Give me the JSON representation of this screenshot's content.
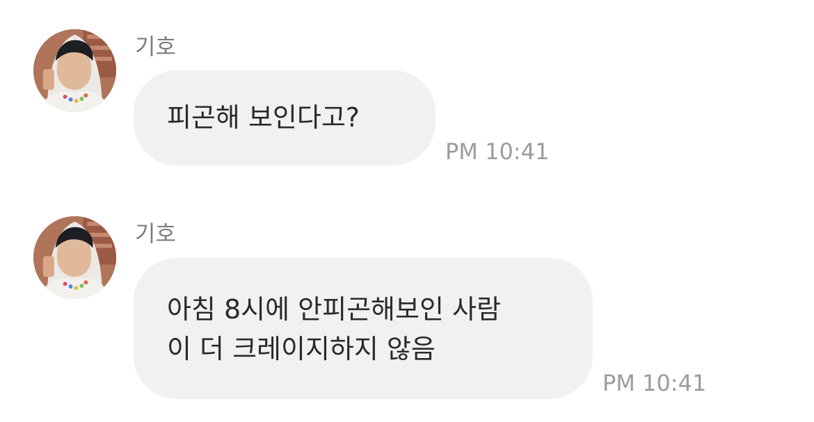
{
  "conversation": {
    "messages": [
      {
        "sender": "기호",
        "text": "피곤해 보인다고?",
        "time": "PM 10:41",
        "avatar": "profile-photo"
      },
      {
        "sender": "기호",
        "text": "아침 8시에 안피곤해보인 사람\n이 더 크레이지하지 않음",
        "time": "PM 10:41",
        "avatar": "profile-photo"
      }
    ]
  },
  "colors": {
    "bubble": "#f1f1f3",
    "message_text": "#2a2a2c",
    "sender_name": "#7d7d7d",
    "timestamp": "#9b9ba0",
    "background": "#ffffff"
  }
}
